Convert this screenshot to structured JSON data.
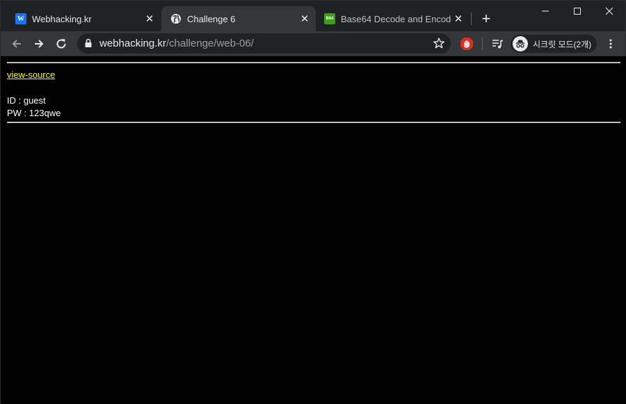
{
  "tabs": [
    {
      "title": "Webhacking.kr",
      "icon": "webhacking-favicon"
    },
    {
      "title": "Challenge 6",
      "icon": "globe-icon"
    },
    {
      "title": "Base64 Decode and Encode",
      "icon": "base64-favicon"
    }
  ],
  "tab_close_glyph": "✕",
  "new_tab_glyph": "+",
  "base64_favicon_text": "B64",
  "webhacking_favicon_text": "W",
  "url": {
    "host": "webhacking.kr",
    "path": "/challenge/web-06/"
  },
  "profile": {
    "label": "시크릿 모드(2개)"
  },
  "page": {
    "link_text": "view-source",
    "id_line": "ID : guest",
    "pw_line": "PW : 123qwe"
  },
  "colors": {
    "tabstrip_bg": "#202124",
    "toolbar_bg": "#35363a",
    "link": "#ffff00",
    "page_bg": "#000000"
  }
}
